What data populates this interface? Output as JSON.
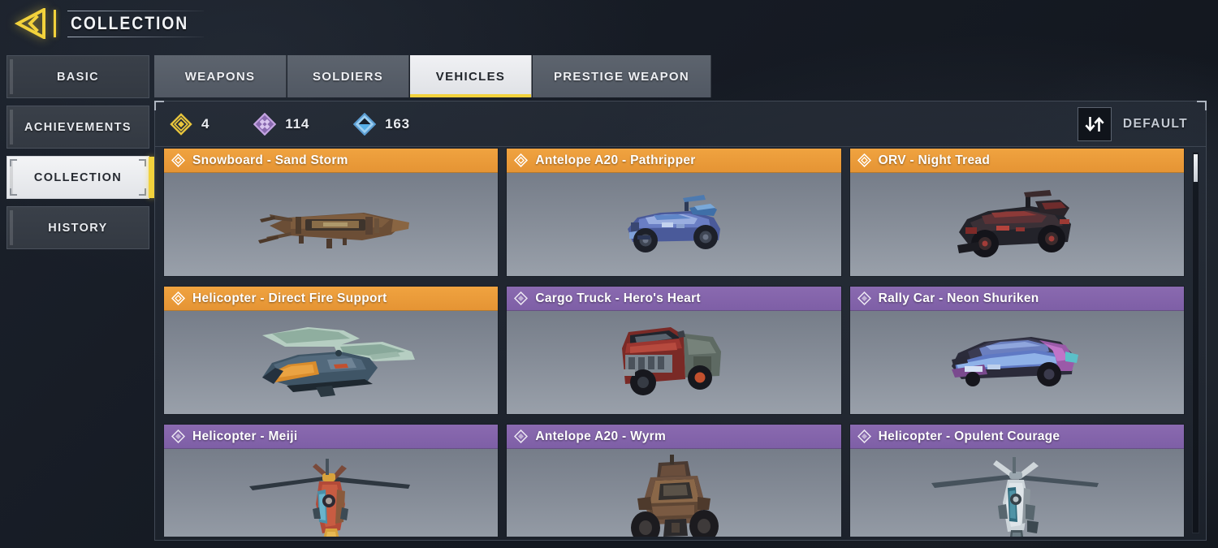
{
  "header": {
    "back_icon": "back-arrow-icon",
    "title": "COLLECTION"
  },
  "sidebar": {
    "items": [
      {
        "label": "BASIC",
        "selected": false
      },
      {
        "label": "ACHIEVEMENTS",
        "selected": false
      },
      {
        "label": "COLLECTION",
        "selected": true
      },
      {
        "label": "HISTORY",
        "selected": false
      }
    ]
  },
  "tabs": [
    {
      "label": "WEAPONS",
      "selected": false
    },
    {
      "label": "SOLDIERS",
      "selected": false
    },
    {
      "label": "VEHICLES",
      "selected": true
    },
    {
      "label": "PRESTIGE WEAPON",
      "selected": false
    }
  ],
  "stats": [
    {
      "icon": "legendary-diamond-icon",
      "color": "#e8c53c",
      "value": "4"
    },
    {
      "icon": "epic-diamond-icon",
      "color": "#b18ad6",
      "value": "114"
    },
    {
      "icon": "rare-diamond-icon",
      "color": "#78b6e8",
      "value": "163"
    }
  ],
  "sort": {
    "icon": "sort-arrows-icon",
    "label": "DEFAULT"
  },
  "colors": {
    "accent_yellow": "#f2d23c",
    "rarity_legendary": "#e59434",
    "rarity_epic": "#7e5fa6",
    "panel_dark": "#2a313c"
  },
  "cards": [
    {
      "title": "Snowboard - Sand Storm",
      "rarity": "orange",
      "art": "snowboard"
    },
    {
      "title": "Antelope A20 - Pathripper",
      "rarity": "orange",
      "art": "buggy-blue"
    },
    {
      "title": "ORV - Night Tread",
      "rarity": "orange",
      "art": "orv-red"
    },
    {
      "title": "Helicopter - Direct Fire Support",
      "rarity": "orange",
      "art": "heli-teal"
    },
    {
      "title": "Cargo Truck - Hero's Heart",
      "rarity": "purple",
      "art": "truck-red"
    },
    {
      "title": "Rally Car - Neon Shuriken",
      "rarity": "purple",
      "art": "rally-neon"
    },
    {
      "title": "Helicopter - Meiji",
      "rarity": "purple",
      "art": "heli-front-red"
    },
    {
      "title": "Antelope A20 - Wyrm",
      "rarity": "purple",
      "art": "buggy-front-rust"
    },
    {
      "title": "Helicopter - Opulent Courage",
      "rarity": "purple",
      "art": "heli-front-teal"
    }
  ]
}
